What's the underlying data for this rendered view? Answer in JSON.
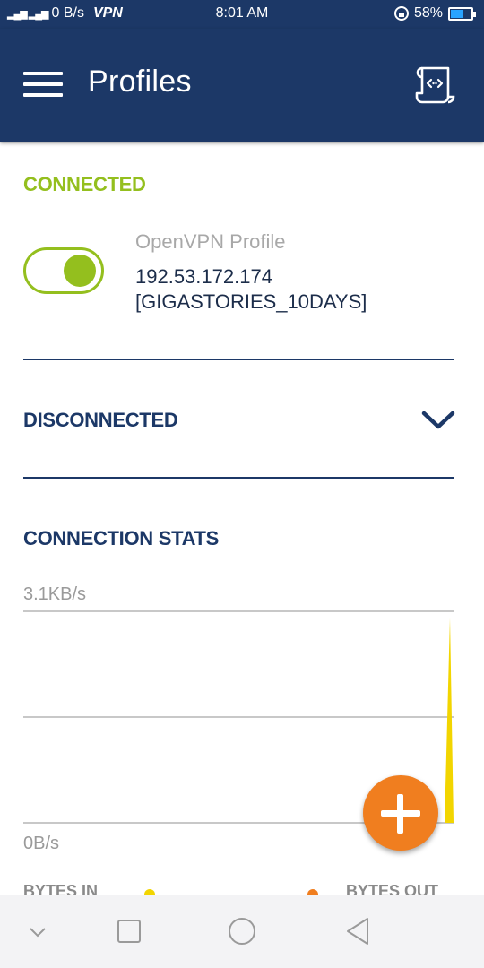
{
  "status_bar": {
    "signal_text": "³ᴳᴵᴴᴳ .ᴵₗ",
    "speed": "0 B/s",
    "vpn": "VPN",
    "time": "8:01 AM",
    "battery": "58%",
    "battery_level": 0.58
  },
  "app_bar": {
    "title": "Profiles"
  },
  "connected_section": {
    "heading": "CONNECTED",
    "toggle_on": true,
    "profile_name": "OpenVPN Profile",
    "address_line1": "192.53.172.174",
    "address_line2": "[GIGASTORIES_10DAYS]"
  },
  "disconnected_section": {
    "heading": "DISCONNECTED"
  },
  "stats_section": {
    "heading": "CONNECTION STATS",
    "y_max_label": "3.1KB/s",
    "y_min_label": "0B/s",
    "legend_in": "BYTES IN",
    "legend_out": "BYTES OUT"
  },
  "colors": {
    "primary": "#1c3867",
    "accent_green": "#94bf1e",
    "fab_orange": "#f07e1f",
    "bytes_in": "#f2d500",
    "bytes_out": "#f07e1f"
  },
  "chart_data": {
    "type": "area",
    "ylabel": "",
    "ylim": [
      0,
      3.1
    ],
    "y_tick_labels": [
      "0B/s",
      "3.1KB/s"
    ],
    "series": [
      {
        "name": "BYTES IN",
        "color": "#f2d500",
        "values": [
          0,
          0,
          0,
          0,
          0,
          0,
          0,
          0,
          0,
          0,
          0,
          0,
          0,
          0,
          0,
          0,
          0,
          0,
          0,
          0,
          0,
          0,
          0,
          0,
          0,
          0,
          0,
          0,
          0,
          3.0
        ]
      },
      {
        "name": "BYTES OUT",
        "color": "#f07e1f",
        "values": [
          0,
          0,
          0,
          0,
          0,
          0,
          0,
          0,
          0,
          0,
          0,
          0,
          0,
          0,
          0,
          0,
          0,
          0,
          0,
          0,
          0,
          0,
          0,
          0,
          0,
          0,
          0,
          0,
          0,
          0
        ]
      }
    ],
    "grid": true
  },
  "nav_bar": {
    "icons": [
      "chevron-down-icon",
      "recents-square-icon",
      "home-circle-icon",
      "back-triangle-icon"
    ]
  }
}
